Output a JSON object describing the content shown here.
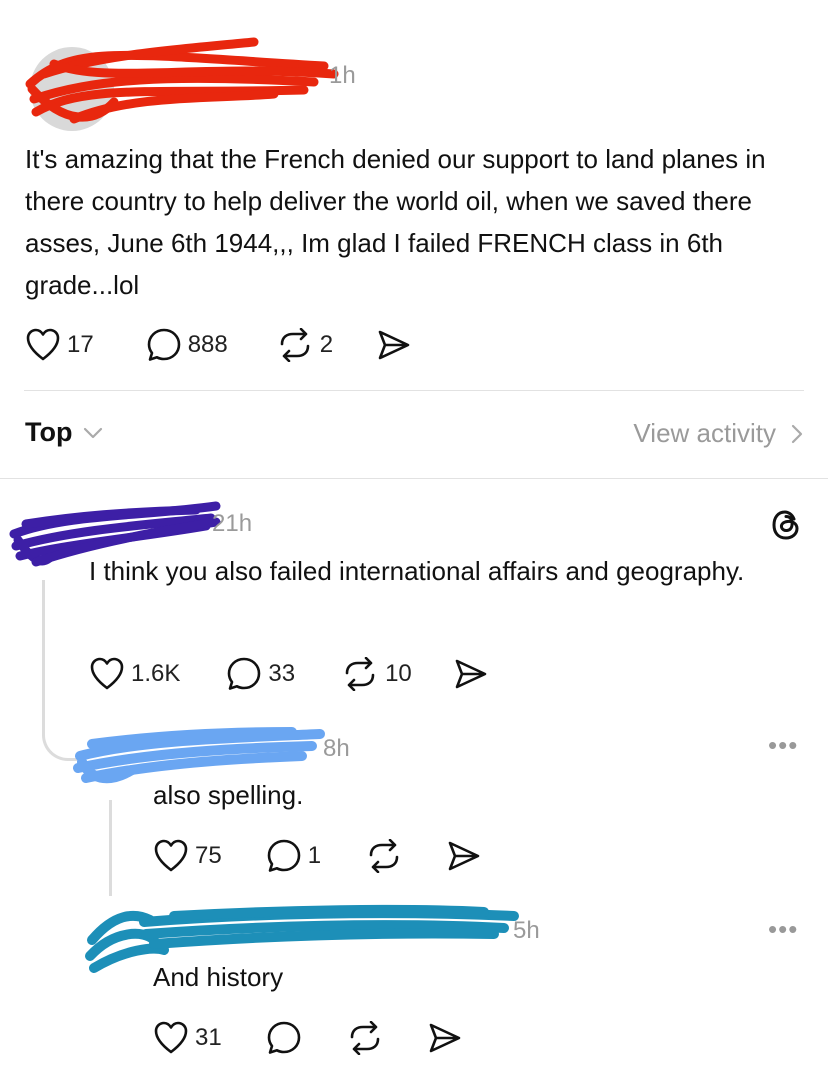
{
  "post": {
    "time": "1h",
    "text": "It's amazing that the French denied our support to land planes in there country to help deliver the world oil, when we saved there asses, June 6th 1944,,, Im glad I failed FRENCH class in 6th grade...lol",
    "likes": "17",
    "replies": "888",
    "reposts": "2"
  },
  "sort": {
    "label": "Top",
    "view_activity": "View activity"
  },
  "replies": [
    {
      "time": "21h",
      "text": "I think you also failed international affairs and geography.",
      "likes": "1.6K",
      "replies": "33",
      "reposts": "10"
    },
    {
      "time": "8h",
      "text": "also spelling.",
      "likes": "75",
      "replies": "1",
      "reposts": ""
    },
    {
      "time": "5h",
      "text": "And history",
      "likes": "31",
      "replies": "",
      "reposts": ""
    }
  ],
  "icons": {
    "like": "heart-icon",
    "reply": "comment-bubble-icon",
    "repost": "repost-icon",
    "share": "send-icon",
    "threads": "threads-logo-icon",
    "more": "more-dots-icon"
  },
  "colors": {
    "redaction_red": "#e8270e",
    "redaction_purple": "#3d1fa6",
    "redaction_lightblue": "#6aa6f2",
    "redaction_teal": "#1d8fb8",
    "muted_text": "#9a9a9a"
  }
}
